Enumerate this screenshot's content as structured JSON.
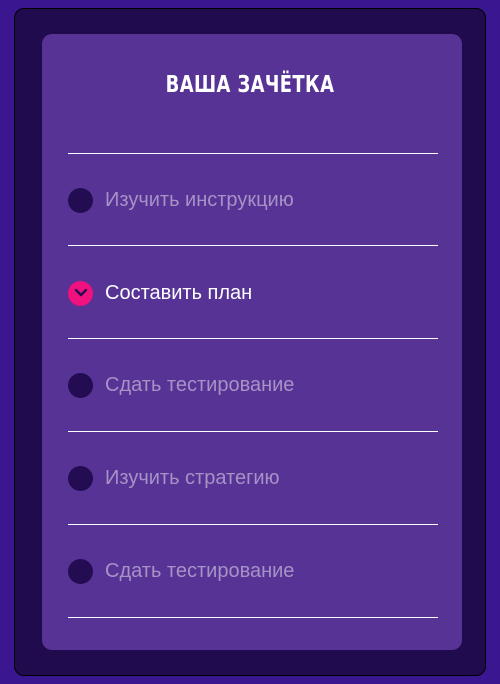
{
  "title": "ВАША ЗАЧЁТКА",
  "colors": {
    "background": "#3a1690",
    "outer_panel": "#1f0b4d",
    "card": "#573396",
    "bullet_inactive": "#230c52",
    "bullet_active": "#f0107e",
    "text_inactive": "#a792c6",
    "text_active": "#ffffff"
  },
  "items": [
    {
      "label": "Изучить инструкцию",
      "active": false,
      "icon": "circle-bullet-icon"
    },
    {
      "label": "Составить план",
      "active": true,
      "icon": "chevron-down-icon"
    },
    {
      "label": "Сдать тестирование",
      "active": false,
      "icon": "circle-bullet-icon"
    },
    {
      "label": "Изучить стратегию",
      "active": false,
      "icon": "circle-bullet-icon"
    },
    {
      "label": "Сдать тестирование",
      "active": false,
      "icon": "circle-bullet-icon"
    }
  ]
}
